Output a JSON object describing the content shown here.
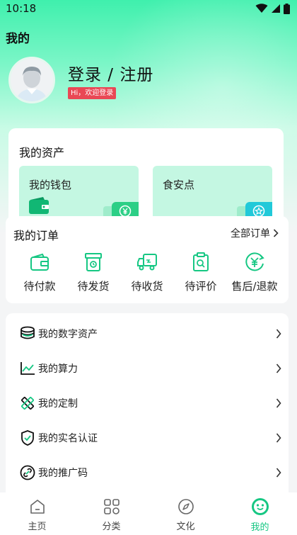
{
  "status": {
    "time": "10:18"
  },
  "header": {
    "title": "我的"
  },
  "profile": {
    "login_label": "登录 / 注册",
    "hint": "Hi，欢迎登录"
  },
  "assets": {
    "title": "我的资产",
    "tiles": [
      {
        "label": "我的钱包",
        "badge_icon": "yuan-icon"
      },
      {
        "label": "食安点",
        "badge_icon": "star-icon"
      }
    ]
  },
  "orders": {
    "title": "我的订单",
    "all_label": "全部订单",
    "items": [
      {
        "label": "待付款",
        "icon": "wallet-icon"
      },
      {
        "label": "待发货",
        "icon": "package-icon"
      },
      {
        "label": "待收货",
        "icon": "truck-icon"
      },
      {
        "label": "待评价",
        "icon": "review-icon"
      },
      {
        "label": "售后/退款",
        "icon": "refund-icon"
      }
    ]
  },
  "menu": [
    {
      "label": "我的数字资产",
      "icon": "coins-icon"
    },
    {
      "label": "我的算力",
      "icon": "chart-icon"
    },
    {
      "label": "我的定制",
      "icon": "tools-icon"
    },
    {
      "label": "我的实名认证",
      "icon": "shield-check-icon"
    },
    {
      "label": "我的推广码",
      "icon": "link-icon"
    }
  ],
  "tabs": [
    {
      "label": "主页",
      "icon": "home-icon"
    },
    {
      "label": "分类",
      "icon": "grid-icon"
    },
    {
      "label": "文化",
      "icon": "compass-icon"
    },
    {
      "label": "我的",
      "icon": "face-icon",
      "active": true
    }
  ],
  "colors": {
    "accent": "#16c783",
    "hero": "#3ff0ad",
    "badge": "#e94855"
  }
}
